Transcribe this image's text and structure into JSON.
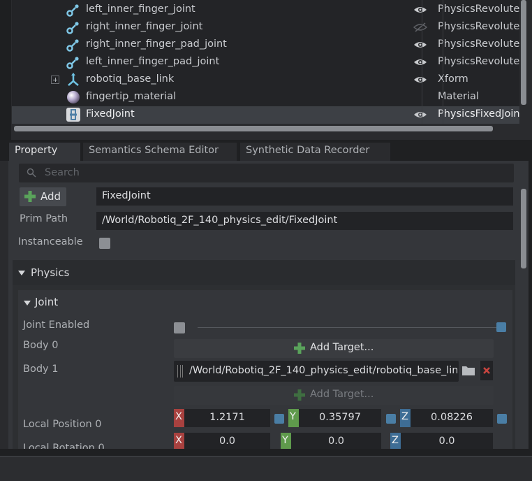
{
  "stage": {
    "rows": [
      {
        "name": "left_inner_finger_joint",
        "type": "PhysicsRevolute",
        "icon": "joint-icon",
        "visible": true
      },
      {
        "name": "right_inner_finger_joint",
        "type": "PhysicsRevolute",
        "icon": "joint-icon",
        "visible": false
      },
      {
        "name": "right_inner_finger_pad_joint",
        "type": "PhysicsRevolute",
        "icon": "joint-icon",
        "visible": true
      },
      {
        "name": "left_inner_finger_pad_joint",
        "type": "PhysicsRevolute",
        "icon": "joint-icon",
        "visible": true
      },
      {
        "name": "robotiq_base_link",
        "type": "Xform",
        "icon": "xform-icon",
        "visible": true
      },
      {
        "name": "fingertip_material",
        "type": "Material",
        "icon": "material-sphere-icon",
        "visible": null
      },
      {
        "name": "FixedJoint",
        "type": "PhysicsFixedJoin",
        "icon": "fixed-joint-icon",
        "visible": true
      }
    ]
  },
  "tabs": [
    "Property",
    "Semantics Schema Editor",
    "Synthetic Data Recorder"
  ],
  "search": {
    "placeholder": "Search"
  },
  "prim": {
    "add_label": "Add",
    "name": "FixedJoint",
    "path_label": "Prim Path",
    "path": "/World/Robotiq_2F_140_physics_edit/FixedJoint",
    "instanceable_label": "Instanceable"
  },
  "physics": {
    "title": "Physics",
    "joint": {
      "title": "Joint",
      "enabled_label": "Joint Enabled",
      "body0_label": "Body 0",
      "body1_label": "Body 1",
      "add_target": "Add Target...",
      "body1_path": "/World/Robotiq_2F_140_physics_edit/robotiq_base_lin",
      "local_position_label": "Local Position 0",
      "local_position": {
        "x": "1.2171",
        "y": "0.35797",
        "z": "0.08226"
      },
      "axis_x": "X",
      "axis_y": "Y",
      "axis_z": "Z",
      "local_rotation_label": "Local Rotation 0",
      "local_rotation": {
        "x": "0.0",
        "y": "0.0",
        "z": "0.0"
      }
    }
  },
  "colors": {
    "accent_blue": "#4a7ea5",
    "x": "#a8413f",
    "y": "#5f9a4c",
    "z": "#3e6d95"
  }
}
